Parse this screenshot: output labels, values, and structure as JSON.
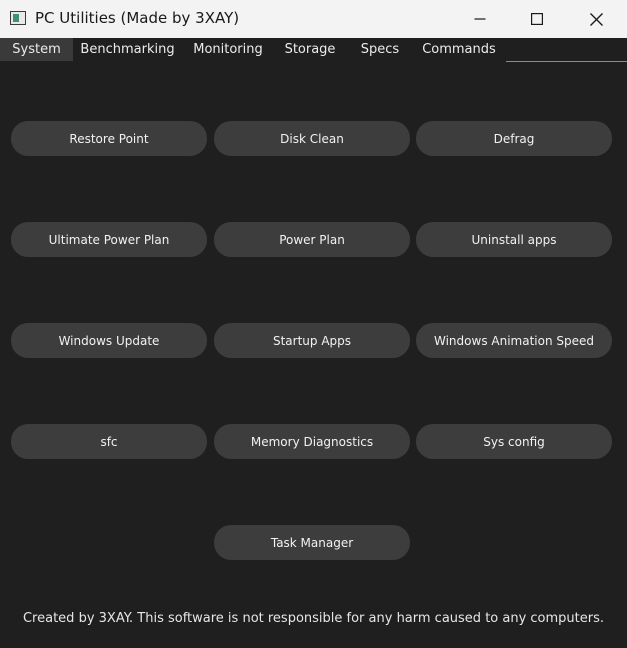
{
  "window": {
    "title": "PC Utilities (Made by 3XAY)",
    "icon": "app-window-icon",
    "controls": [
      "minimize-icon",
      "maximize-icon",
      "close-icon"
    ]
  },
  "tabs": [
    {
      "label": "System",
      "active": true
    },
    {
      "label": "Benchmarking",
      "active": false
    },
    {
      "label": "Monitoring",
      "active": false
    },
    {
      "label": "Storage",
      "active": false
    },
    {
      "label": "Specs",
      "active": false
    },
    {
      "label": "Commands",
      "active": false
    }
  ],
  "buttons": [
    {
      "label": "Restore Point"
    },
    {
      "label": "Disk Clean"
    },
    {
      "label": "Defrag"
    },
    {
      "label": "Ultimate Power Plan"
    },
    {
      "label": "Power Plan"
    },
    {
      "label": "Uninstall apps"
    },
    {
      "label": "Windows Update"
    },
    {
      "label": "Startup Apps"
    },
    {
      "label": "Windows Animation Speed"
    },
    {
      "label": "sfc"
    },
    {
      "label": "Memory Diagnostics"
    },
    {
      "label": "Sys config"
    },
    {
      "label": "Task Manager"
    }
  ],
  "footer": {
    "text": "Created by 3XAY. This software is not responsible for any harm caused to any computers."
  },
  "colors": {
    "background": "#1f1f1f",
    "button": "#3d3d3d",
    "active_tab": "#3a3a3a",
    "titlebar": "#f3f3f3"
  }
}
